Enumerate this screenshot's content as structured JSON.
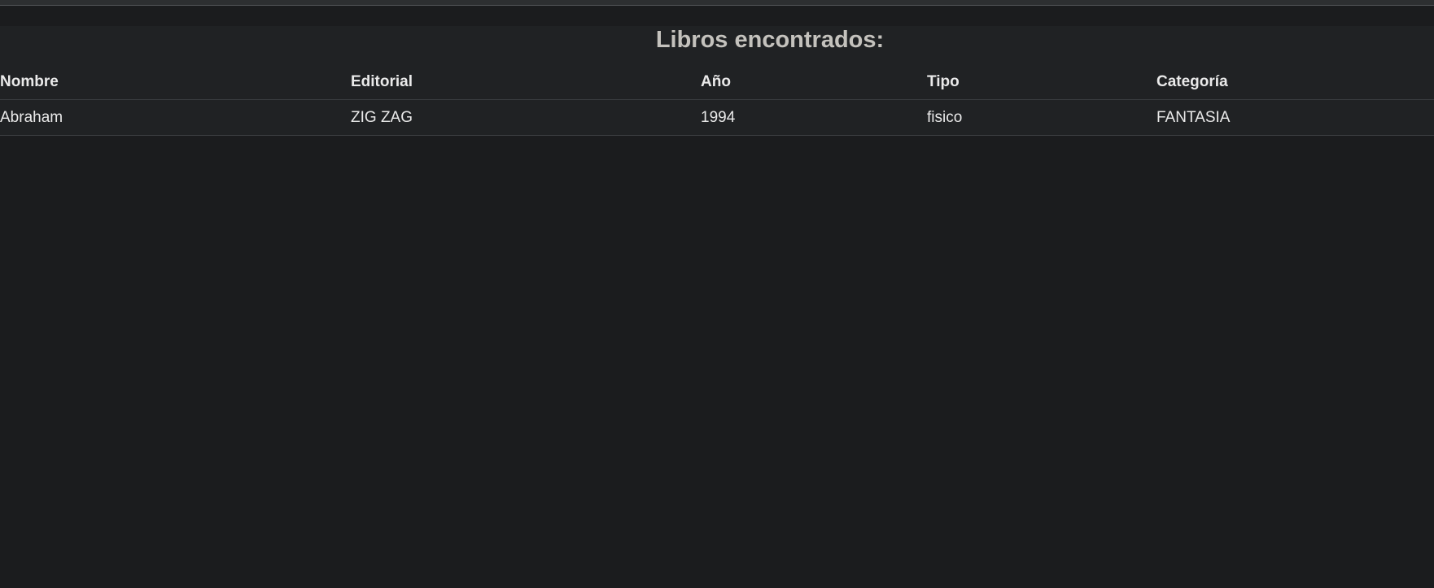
{
  "heading": "Libros encontrados:",
  "table": {
    "columns": [
      "Nombre",
      "Editorial",
      "Año",
      "Tipo",
      "Categoría"
    ],
    "rows": [
      [
        "Abraham",
        "ZIG ZAG",
        "1994",
        "fisico",
        "FANTASIA"
      ]
    ]
  },
  "colors": {
    "page_background": "#1b1c1e",
    "panel_background": "#202224",
    "heading_text": "#c4c2bd",
    "table_text": "#eaeaea"
  }
}
